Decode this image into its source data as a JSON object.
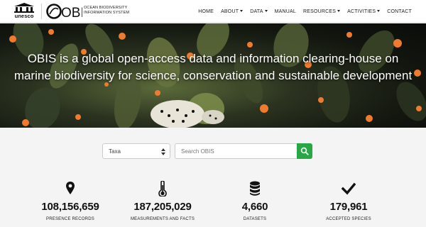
{
  "header": {
    "unesco_text": "unesco",
    "obis_logo_text": "OBIS",
    "obis_subtitle_line1": "OCEAN BIODIVERSITY",
    "obis_subtitle_line2": "INFORMATION SYSTEM",
    "nav": [
      {
        "label": "HOME",
        "has_dropdown": false
      },
      {
        "label": "ABOUT",
        "has_dropdown": true
      },
      {
        "label": "DATA",
        "has_dropdown": true
      },
      {
        "label": "MANUAL",
        "has_dropdown": false
      },
      {
        "label": "RESOURCES",
        "has_dropdown": true
      },
      {
        "label": "ACTIVITIES",
        "has_dropdown": true
      },
      {
        "label": "CONTACT",
        "has_dropdown": false
      }
    ]
  },
  "hero": {
    "tagline": "OBIS is a global open-access data and information clearing-house on marine biodiversity for science, conservation and sustainable development"
  },
  "search": {
    "type_selected": "Taxa",
    "placeholder": "Search OBIS",
    "value": "",
    "button_icon": "search-icon",
    "button_color": "#28a745"
  },
  "stats": [
    {
      "icon": "map-marker-icon",
      "value": "108,156,659",
      "label": "PRESENCE RECORDS"
    },
    {
      "icon": "thermometer-icon",
      "value": "187,205,029",
      "label": "MEASUREMENTS AND FACTS"
    },
    {
      "icon": "database-icon",
      "value": "4,660",
      "label": "DATASETS"
    },
    {
      "icon": "checkmark-icon",
      "value": "179,961",
      "label": "ACCEPTED SPECIES"
    }
  ]
}
